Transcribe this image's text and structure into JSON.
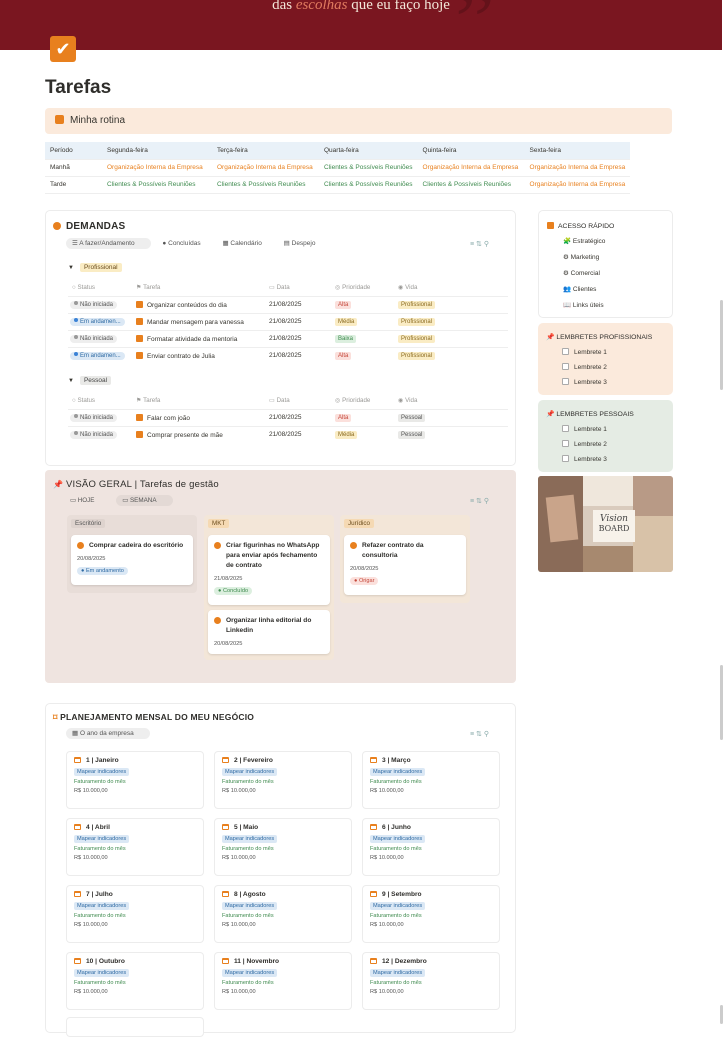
{
  "banner": {
    "quote_before": "das",
    "quote_emph": "escolhas",
    "quote_after": "que eu faço hoje"
  },
  "page": {
    "title": "Tarefas"
  },
  "callout": {
    "text": "Minha rotina"
  },
  "rotina": {
    "headers": [
      "Período",
      "Segunda-feira",
      "Terça-feira",
      "Quarta-feira",
      "Quinta-feira",
      "Sexta-feira"
    ],
    "rows": [
      {
        "periodo": "Manhã",
        "cells": [
          "Organização Interna da Empresa",
          "Organização Interna da Empresa",
          "Clientes & Possíveis Reuniões",
          "Organização Interna da Empresa",
          "Organização Interna da Empresa"
        ]
      },
      {
        "periodo": "Tarde",
        "cells": [
          "Clientes & Possíveis Reuniões",
          "Clientes & Possíveis Reuniões",
          "Clientes & Possíveis Reuniões",
          "Clientes & Possíveis Reuniões",
          "Organização Interna da Empresa"
        ]
      }
    ]
  },
  "demandas": {
    "title": "DEMANDAS",
    "tabs": [
      "A fazer/Andamento",
      "Concluídas",
      "Calendário",
      "Despejo"
    ],
    "columns": [
      "Status",
      "Tarefa",
      "Data",
      "Prioridade",
      "Vida"
    ],
    "groups": [
      {
        "name": "Profissional",
        "rows": [
          {
            "status": "Não iniciada",
            "task": "Organizar conteúdos do dia",
            "date": "21/08/2025",
            "priority": "Alta",
            "vida": "Profissional"
          },
          {
            "status": "Em andamen...",
            "task": "Mandar mensagem para vanessa",
            "date": "21/08/2025",
            "priority": "Média",
            "vida": "Profissional"
          },
          {
            "status": "Não iniciada",
            "task": "Formatar atividade da mentoria",
            "date": "21/08/2025",
            "priority": "Baixa",
            "vida": "Profissional"
          },
          {
            "status": "Em andamen...",
            "task": "Enviar contrato de Julia",
            "date": "21/08/2025",
            "priority": "Alta",
            "vida": "Profissional"
          }
        ]
      },
      {
        "name": "Pessoal",
        "rows": [
          {
            "status": "Não iniciada",
            "task": "Falar com joão",
            "date": "21/08/2025",
            "priority": "Alta",
            "vida": "Pessoal"
          },
          {
            "status": "Não iniciada",
            "task": "Comprar presente de mãe",
            "date": "21/08/2025",
            "priority": "Média",
            "vida": "Pessoal"
          }
        ]
      }
    ]
  },
  "acesso": {
    "title": "ACESSO RÁPIDO",
    "items": [
      "Estratégico",
      "Marketing",
      "Comercial",
      "Clientes",
      "Links úteis"
    ]
  },
  "lembretes_prof": {
    "title": "LEMBRETES PROFISSIONAIS",
    "items": [
      "Lembrete 1",
      "Lembrete 2",
      "Lembrete 3"
    ]
  },
  "lembretes_pess": {
    "title": "LEMBRETES PESSOAIS",
    "items": [
      "Lembrete 1",
      "Lembrete 2",
      "Lembrete 3"
    ]
  },
  "visionboard": {
    "line1": "Vision",
    "line2": "BOARD"
  },
  "visao": {
    "title": "VISÃO GERAL | Tarefas de gestão",
    "tabs": [
      "HOJE",
      "SEMANA"
    ],
    "columns": [
      {
        "name": "Escritório",
        "cards": [
          {
            "title": "Comprar cadeira do escritório",
            "date": "20/08/2025",
            "status": "Em andamento"
          }
        ]
      },
      {
        "name": "MKT",
        "cards": [
          {
            "title": "Criar figurinhas no WhatsApp para enviar após fechamento de contrato",
            "date": "21/08/2025",
            "status": "Concluído"
          },
          {
            "title": "Organizar linha editorial do Linkedin",
            "date": "20/08/2025",
            "status": ""
          }
        ]
      },
      {
        "name": "Jurídico",
        "cards": [
          {
            "title": "Refazer contrato da consultoria",
            "date": "20/08/2025",
            "status": "Origar"
          }
        ]
      }
    ]
  },
  "planejamento": {
    "title": "PLANEJAMENTO MENSAL DO MEU NEGÓCIO",
    "tab": "O ano da empresa",
    "months": [
      {
        "title": "1 | Janeiro",
        "tag": "Mapear indicadores",
        "fat": "Faturamento do mês",
        "value": "R$ 10.000,00"
      },
      {
        "title": "2 | Fevereiro",
        "tag": "Mapear indicadores",
        "fat": "Faturamento do mês",
        "value": "R$ 10.000,00"
      },
      {
        "title": "3 | Março",
        "tag": "Mapear indicadores",
        "fat": "Faturamento do mês",
        "value": "R$ 10.000,00"
      },
      {
        "title": "4 | Abril",
        "tag": "Mapear indicadores",
        "fat": "Faturamento do mês",
        "value": "R$ 10.000,00"
      },
      {
        "title": "5 | Maio",
        "tag": "Mapear indicadores",
        "fat": "Faturamento do mês",
        "value": "R$ 10.000,00"
      },
      {
        "title": "6 | Junho",
        "tag": "Mapear indicadores",
        "fat": "Faturamento do mês",
        "value": "R$ 10.000,00"
      },
      {
        "title": "7 | Julho",
        "tag": "Mapear indicadores",
        "fat": "Faturamento do mês",
        "value": "R$ 10.000,00"
      },
      {
        "title": "8 | Agosto",
        "tag": "Mapear indicadores",
        "fat": "Faturamento do mês",
        "value": "R$ 10.000,00"
      },
      {
        "title": "9 | Setembro",
        "tag": "Mapear indicadores",
        "fat": "Faturamento do mês",
        "value": "R$ 10.000,00"
      },
      {
        "title": "10 | Outubro",
        "tag": "Mapear indicadores",
        "fat": "Faturamento do mês",
        "value": "R$ 10.000,00"
      },
      {
        "title": "11 | Novembro",
        "tag": "Mapear indicadores",
        "fat": "Faturamento do mês",
        "value": "R$ 10.000,00"
      },
      {
        "title": "12 | Dezembro",
        "tag": "Mapear indicadores",
        "fat": "Faturamento do mês",
        "value": "R$ 10.000,00"
      }
    ]
  },
  "colors": {
    "accent": "#e8801e",
    "banner": "#7a1620",
    "callout": "#fbeadc",
    "kanban": "#efe4e0"
  }
}
